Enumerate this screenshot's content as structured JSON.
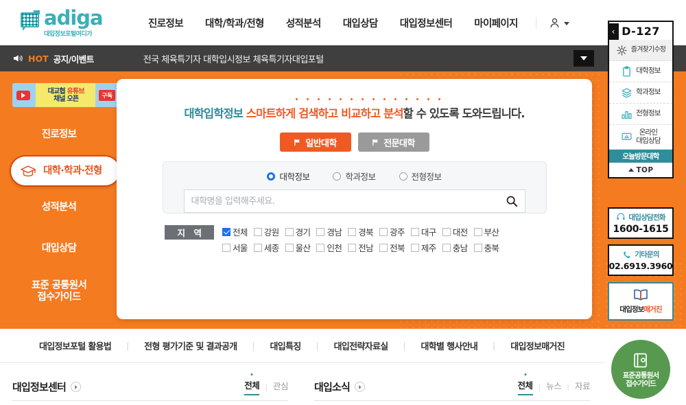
{
  "header": {
    "logo_word": "adiga",
    "logo_sub": "대입정보포털여디가",
    "nav": [
      {
        "label": "진로정보"
      },
      {
        "label": "대학/학과/전형"
      },
      {
        "label": "성적분석"
      },
      {
        "label": "대입상담"
      },
      {
        "label": "대입정보센터"
      },
      {
        "label": "마이페이지"
      }
    ]
  },
  "notice": {
    "hot": "HOT",
    "label": "공지/이벤트",
    "text": "전국 체육특기자 대학입시정보 체육특기자대입포털"
  },
  "hero": {
    "youtube_banner": {
      "line1_a": "대교협",
      "line1_b": "유튜브",
      "line2": "채널 오픈",
      "subscribe": "구독"
    },
    "sidebar": [
      {
        "label": "진로정보",
        "active": false
      },
      {
        "label": "대학·학과·전형",
        "active": true
      },
      {
        "label": "성적분석",
        "active": false
      },
      {
        "label": "대입상담",
        "active": false
      },
      {
        "label": "표준 공통원서\n접수가이드",
        "active": false
      }
    ]
  },
  "card": {
    "headline": {
      "teal": "대학입학정보",
      "orange": " 스마트하게 검색하고 비교하고 분석",
      "tail": "할 수 있도록 도와드립니다."
    },
    "tabs": [
      {
        "label": "일반대학",
        "selected": true
      },
      {
        "label": "전문대학",
        "selected": false
      }
    ],
    "radios": [
      {
        "label": "대학정보",
        "selected": true
      },
      {
        "label": "학과정보",
        "selected": false
      },
      {
        "label": "전형정보",
        "selected": false
      }
    ],
    "search": {
      "placeholder": "대학명을 입력해주세요.",
      "value": ""
    },
    "region": {
      "label_a": "지",
      "label_b": "역",
      "row1": [
        {
          "label": "전체",
          "checked": true
        },
        {
          "label": "강원",
          "checked": false
        },
        {
          "label": "경기",
          "checked": false
        },
        {
          "label": "경남",
          "checked": false
        },
        {
          "label": "경북",
          "checked": false
        },
        {
          "label": "광주",
          "checked": false
        },
        {
          "label": "대구",
          "checked": false
        },
        {
          "label": "대전",
          "checked": false
        },
        {
          "label": "부산",
          "checked": false
        }
      ],
      "row2": [
        {
          "label": "서울",
          "checked": false
        },
        {
          "label": "세종",
          "checked": false
        },
        {
          "label": "울산",
          "checked": false
        },
        {
          "label": "인천",
          "checked": false
        },
        {
          "label": "전남",
          "checked": false
        },
        {
          "label": "전북",
          "checked": false
        },
        {
          "label": "제주",
          "checked": false
        },
        {
          "label": "충남",
          "checked": false
        },
        {
          "label": "충북",
          "checked": false
        }
      ]
    }
  },
  "quick_links": [
    {
      "label": "대입정보포털 활용법"
    },
    {
      "label": "전형 평가기준 및 결과공개"
    },
    {
      "label": "대입특징"
    },
    {
      "label": "대입전략자료실"
    },
    {
      "label": "대학별 행사안내"
    },
    {
      "label": "대입정보매거진"
    }
  ],
  "bottom_sections": [
    {
      "title": "대입정보센터",
      "filters": [
        {
          "label": "전체",
          "active": true
        },
        {
          "label": "관심",
          "active": false
        }
      ]
    },
    {
      "title": "대입소식",
      "filters": [
        {
          "label": "전체",
          "active": true
        },
        {
          "label": "뉴스",
          "active": false
        },
        {
          "label": "자료",
          "active": false
        }
      ]
    }
  ],
  "rail": {
    "dday": "D-127",
    "collapse": "‹",
    "menu": [
      {
        "label": "즐겨찾기수정",
        "icon": "gear-icon"
      },
      {
        "label": "대학정보",
        "icon": "clipboard-icon"
      },
      {
        "label": "학과정보",
        "icon": "layers-icon"
      },
      {
        "label": "전형정보",
        "icon": "bar-chart-icon"
      },
      {
        "label": "온라인\n대입상담",
        "icon": "monitor-icon"
      }
    ],
    "today_button": "오늘방문대학",
    "top_button": "TOP",
    "boxes": [
      {
        "title": "대입상담전화",
        "number": "1600-1615",
        "icon": "headset-icon"
      },
      {
        "title": "기타문의",
        "number": "02.6919.3960",
        "icon": "phone-icon"
      }
    ],
    "magazine": {
      "label_a": "대입정보",
      "label_b": "매거진",
      "icon": "book-icon"
    },
    "circle": {
      "line1": "표준공통원서",
      "line2": "접수가이드",
      "icon": "guide-book-icon"
    }
  },
  "colors": {
    "orange": "#f47b20",
    "teal": "#2f8d9c",
    "dark": "#3f3f3f",
    "green": "#57994f",
    "accent_orange": "#f05a22"
  }
}
